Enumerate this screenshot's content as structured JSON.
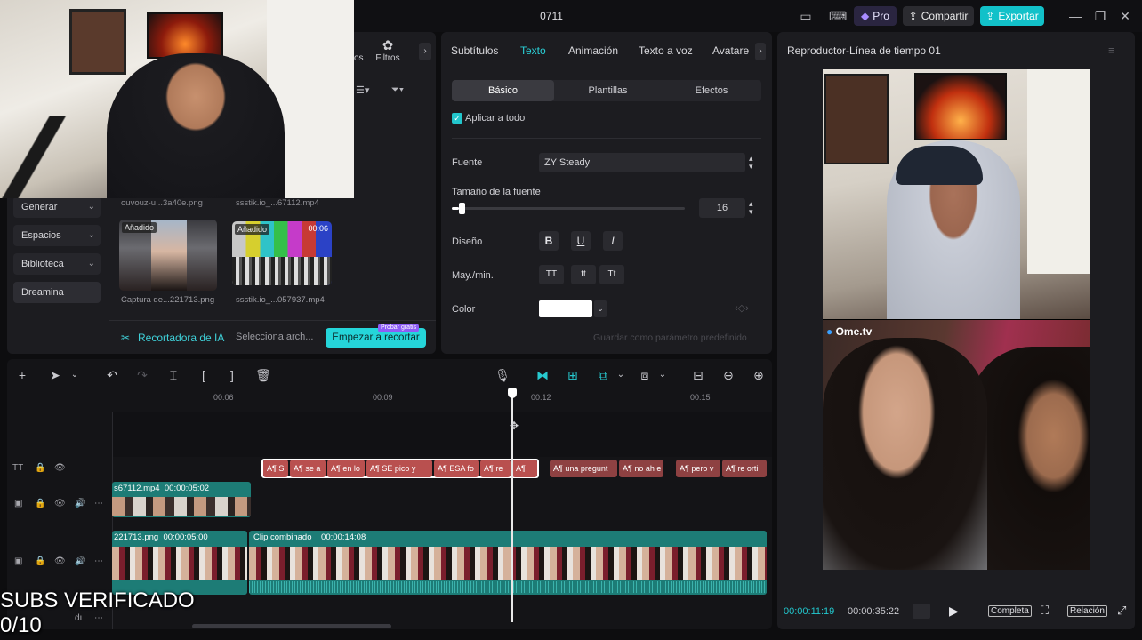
{
  "app": {
    "title": "0711",
    "buttons": {
      "pro": "Pro",
      "share": "Compartir",
      "export": "Exportar"
    }
  },
  "media_panel": {
    "top_tab": "Filtros",
    "partial_tab": "os",
    "sidebar": [
      {
        "label": "Generar"
      },
      {
        "label": "Espacios"
      },
      {
        "label": "Biblioteca"
      },
      {
        "label": "Dreamina"
      }
    ],
    "partial_captions": [
      "ouvouz-u...3a40e.png",
      "ssstik.io_...67112.mp4"
    ],
    "thumbs": [
      {
        "badge": "Añadido",
        "caption": "Captura de...221713.png",
        "duration": ""
      },
      {
        "badge": "Añadido",
        "caption": "ssstik.io_...057937.mp4",
        "duration": "00:06"
      }
    ],
    "ai_bar": {
      "label": "Recortadora de IA",
      "select": "Selecciona arch...",
      "cta": "Empezar a recortar",
      "badge": "Probar gratis"
    }
  },
  "text_panel": {
    "tabs": [
      "Subtítulos",
      "Texto",
      "Animación",
      "Texto a voz",
      "Avatare"
    ],
    "active_tab": "Texto",
    "subtabs": [
      "Básico",
      "Plantillas",
      "Efectos"
    ],
    "apply_all": "Aplicar a todo",
    "font_label": "Fuente",
    "font_value": "ZY Steady",
    "size_label": "Tamaño de la fuente",
    "size_value": "16",
    "size_fraction": 0.03,
    "design_label": "Diseño",
    "design_buttons": [
      "B",
      "U",
      "I"
    ],
    "case_label": "May./min.",
    "case_buttons": [
      "TT",
      "tt",
      "Tt"
    ],
    "color_label": "Color",
    "color_value": "#ffffff",
    "save_default": "Guardar como parámetro predefinido"
  },
  "player": {
    "title": "Reproductor-Línea de tiempo 01",
    "watermark": "Ome.tv",
    "current_time": "00:00:11:19",
    "total_time": "00:00:35:22",
    "btn_full": "Completa",
    "btn_ratio": "Relación"
  },
  "timeline": {
    "ruler": [
      "00:06",
      "00:09",
      "00:12",
      "00:15"
    ],
    "text_clips": [
      "S",
      "se a",
      "en lo",
      "SE pico y",
      "ESA fo",
      "re",
      "",
      "una pregunt",
      "no ah e",
      "pero v",
      "re orti"
    ],
    "video_clip1": {
      "name": "s67112.mp4",
      "duration": "00:00:05:02"
    },
    "video_clip2": {
      "name": "221713.png",
      "duration": "00:00:05:00"
    },
    "compound_clip": {
      "name": "Clip combinado",
      "duration": "00:00:14:08"
    }
  },
  "overlay": {
    "line1": "SUBS VERIFICADO",
    "line2": "0/10"
  },
  "colors": {
    "accent": "#12c1c9",
    "text_clip": "#b9504f",
    "video_track": "#1d7c76"
  }
}
